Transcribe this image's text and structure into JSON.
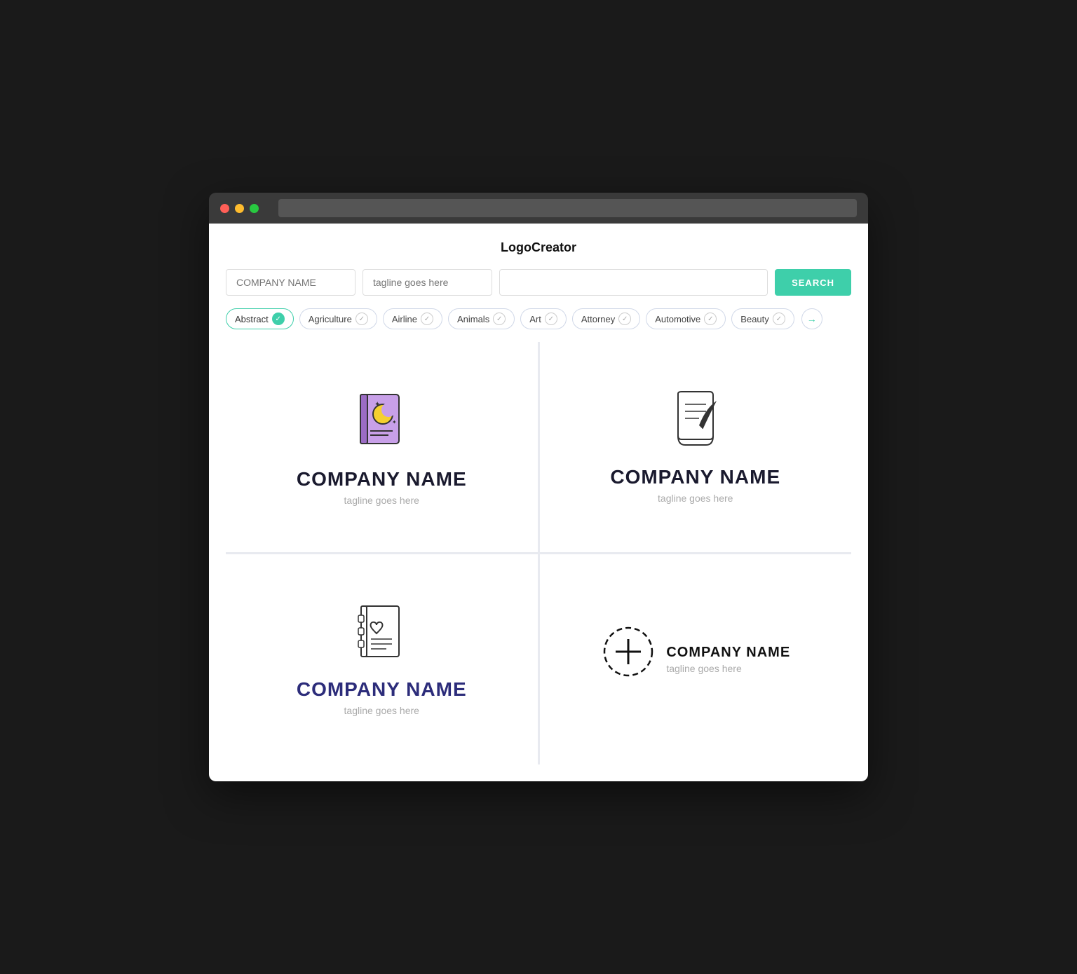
{
  "app": {
    "title": "LogoCreator"
  },
  "search": {
    "company_placeholder": "COMPANY NAME",
    "tagline_placeholder": "tagline goes here",
    "extra_placeholder": "",
    "button_label": "SEARCH"
  },
  "filters": [
    {
      "label": "Abstract",
      "active": true
    },
    {
      "label": "Agriculture",
      "active": false
    },
    {
      "label": "Airline",
      "active": false
    },
    {
      "label": "Animals",
      "active": false
    },
    {
      "label": "Art",
      "active": false
    },
    {
      "label": "Attorney",
      "active": false
    },
    {
      "label": "Automotive",
      "active": false
    },
    {
      "label": "Beauty",
      "active": false
    }
  ],
  "logos": [
    {
      "id": 1,
      "company_name": "COMPANY NAME",
      "tagline": "tagline goes here",
      "name_color": "dark",
      "layout": "vertical",
      "icon_type": "magic-book"
    },
    {
      "id": 2,
      "company_name": "COMPANY NAME",
      "tagline": "tagline goes here",
      "name_color": "dark",
      "layout": "vertical",
      "icon_type": "document-quill"
    },
    {
      "id": 3,
      "company_name": "COMPANY NAME",
      "tagline": "tagline goes here",
      "name_color": "navy",
      "layout": "vertical",
      "icon_type": "address-book"
    },
    {
      "id": 4,
      "company_name": "COMPANY NAME",
      "tagline": "tagline goes here",
      "name_color": "black",
      "layout": "inline",
      "icon_type": "circle-plus"
    }
  ]
}
